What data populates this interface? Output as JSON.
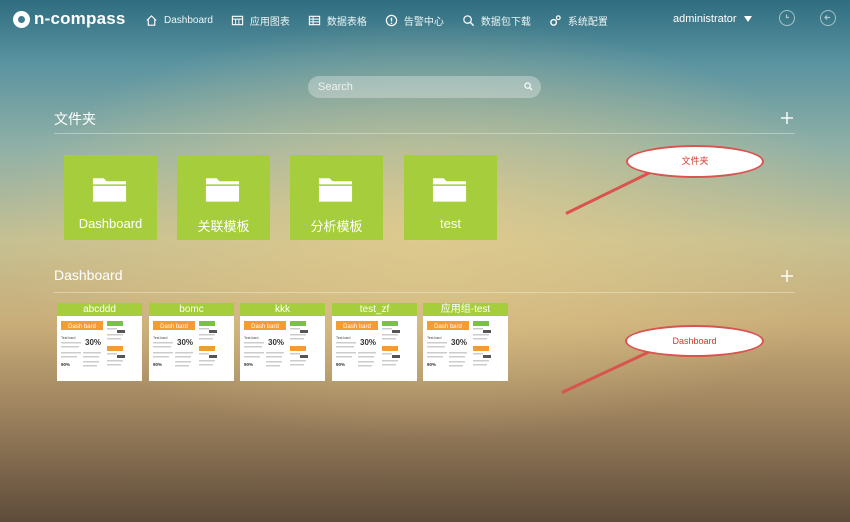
{
  "app": {
    "logo_text": "n-compass"
  },
  "nav": {
    "items": [
      {
        "label": "Dashboard",
        "icon": "home-icon"
      },
      {
        "label": "应用图表",
        "icon": "table-icon"
      },
      {
        "label": "数据表格",
        "icon": "grid-icon"
      },
      {
        "label": "告警中心",
        "icon": "alert-icon"
      },
      {
        "label": "数据包下载",
        "icon": "search-icon"
      },
      {
        "label": "系统配置",
        "icon": "gears-icon"
      }
    ]
  },
  "user": {
    "name": "administrator"
  },
  "search": {
    "placeholder": "Search"
  },
  "folders": {
    "title": "文件夹",
    "items": [
      {
        "label": "Dashboard"
      },
      {
        "label": "关联模板"
      },
      {
        "label": "分析模板"
      },
      {
        "label": "test"
      }
    ]
  },
  "dashboards": {
    "title": "Dashboard",
    "items": [
      {
        "label": "abcddd"
      },
      {
        "label": "bomc"
      },
      {
        "label": "kkk"
      },
      {
        "label": "test_zf"
      },
      {
        "label": "应用组-test"
      }
    ],
    "thumb": {
      "banner": "Dash bard",
      "big_value": "30%",
      "small_value": "90%",
      "tag": "Test bard"
    }
  },
  "annotations": {
    "folder_callout": "文件夹",
    "dashboard_callout": "Dashboard"
  },
  "colors": {
    "accent_green": "#a6cd3c",
    "thumb_orange": "#f39c33",
    "callout_red": "#d9534f"
  }
}
